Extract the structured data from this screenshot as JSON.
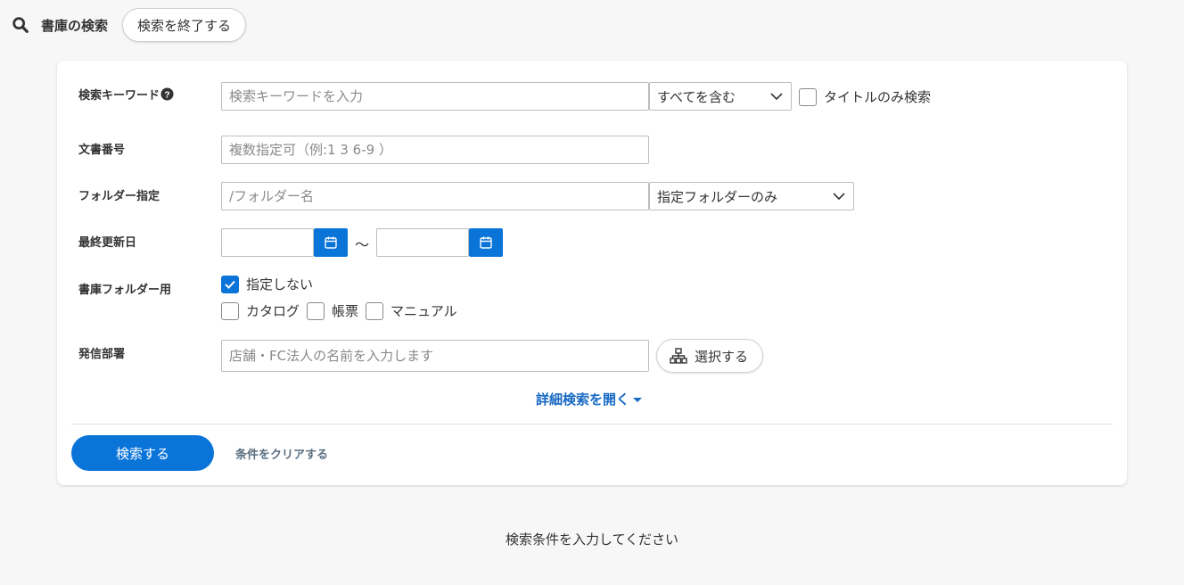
{
  "header": {
    "title": "書庫の検索",
    "end_search_label": "検索を終了する"
  },
  "form": {
    "keyword": {
      "label": "検索キーワード",
      "placeholder": "検索キーワードを入力",
      "match_mode": "すべてを含む",
      "title_only_label": "タイトルのみ検索"
    },
    "doc_number": {
      "label": "文書番号",
      "placeholder": "複数指定可（例:1 3 6-9 ）"
    },
    "folder": {
      "label": "フォルダー指定",
      "placeholder": "/フォルダー名",
      "scope": "指定フォルダーのみ"
    },
    "updated": {
      "label": "最終更新日",
      "separator": "〜"
    },
    "library_folder": {
      "label": "書庫フォルダー用",
      "options": [
        {
          "label": "指定しない",
          "checked": true
        },
        {
          "label": "カタログ",
          "checked": false
        },
        {
          "label": "帳票",
          "checked": false
        },
        {
          "label": "マニュアル",
          "checked": false
        }
      ]
    },
    "department": {
      "label": "発信部署",
      "placeholder": "店舗・FC法人の名前を入力します",
      "select_label": "選択する"
    },
    "advanced_label": "詳細検索を開く",
    "search_label": "検索する",
    "clear_label": "条件をクリアする"
  },
  "footer": {
    "message": "検索条件を入力してください"
  },
  "colors": {
    "primary": "#0a74d9",
    "link": "#1769c4",
    "background": "#f7f7f8"
  }
}
